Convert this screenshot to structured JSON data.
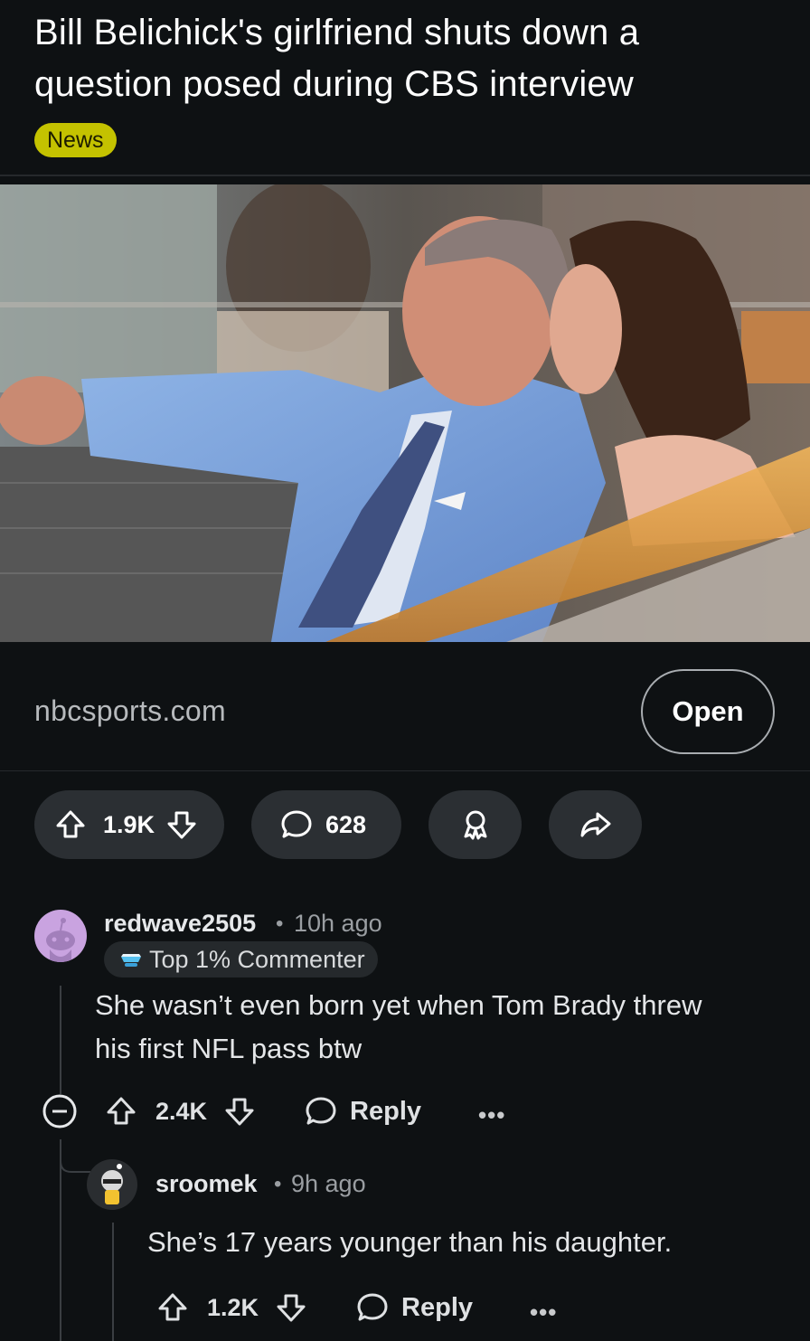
{
  "post": {
    "title": "Bill Belichick's girlfriend shuts down a question posed during CBS interview",
    "flair": "News",
    "image_alt": "Bill Belichick in a light blue suit seated beside a woman with long brown hair",
    "link_domain": "nbcsports.com",
    "open_label": "Open",
    "upvotes": "1.9K",
    "comments": "628"
  },
  "comments": [
    {
      "username": "redwave2505",
      "separator": "•",
      "time": "10h ago",
      "badge": "Top 1% Commenter",
      "body_line1": "She wasn’t even born yet when Tom Brady threw",
      "body_line2": "his first NFL pass btw",
      "votes": "2.4K",
      "reply_label": "Reply",
      "more": "•••"
    },
    {
      "username": "sroomek",
      "separator": "•",
      "time": "9h ago",
      "body_line1": "She’s 17 years younger than his daughter.",
      "votes": "1.2K",
      "reply_label": "Reply",
      "more": "•••"
    }
  ],
  "colors": {
    "background": "#0e1113",
    "flair": "#c4c200",
    "pill": "#2b2f33",
    "avatar_purple": "#c9a3e0"
  }
}
